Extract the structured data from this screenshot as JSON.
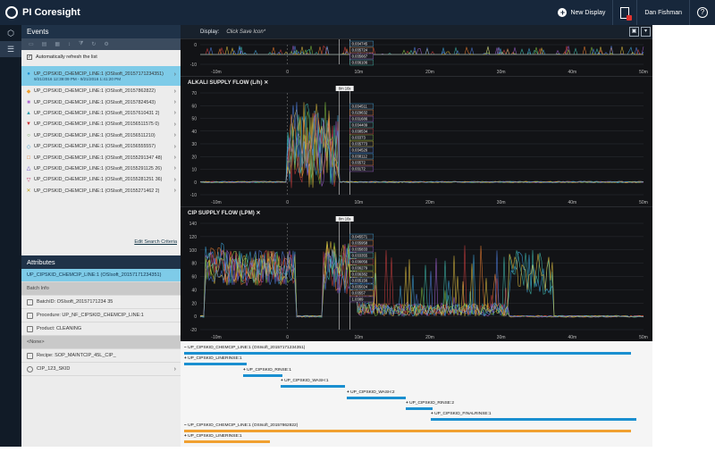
{
  "app": {
    "name_pi": "PI",
    "name_rest": "Coresight"
  },
  "topbar": {
    "new_display": "New Display",
    "user": "Dan Fishman",
    "help": "?"
  },
  "events": {
    "header": "Events",
    "auto_refresh": "Automatically refresh the list",
    "edit_search": "Edit Search Criteria",
    "items": [
      {
        "label": "UP_CIPSKID_CHEMCIP_LINE:1 (OSIsoft_20157171234351)",
        "sub": "9/21/2016 12:39:09 PM - 9/21/2016 1:41:20 PM",
        "marker": "●",
        "color": "#1a8fd0"
      },
      {
        "label": "UP_CIPSKID_CHEMCIP_LINE:1 (OSIsoft_20157862822)",
        "marker": "◆",
        "color": "#f0a030"
      },
      {
        "label": "UP_CIPSKID_CHEMCIP_LINE:1 (OSIsoft_20157824543)",
        "marker": "■",
        "color": "#b06ad0"
      },
      {
        "label": "UP_CIPSKID_CHEMCIP_LINE:1 (OSIsoft_20157610431 2)",
        "marker": "▲",
        "color": "#2a9fb0"
      },
      {
        "label": "UP_CIPSKID_CHEMCIP_LINE:1 (OSIsoft_20156511575 0)",
        "marker": "▼",
        "color": "#d03030"
      },
      {
        "label": "UP_CIPSKID_CHEMCIP_LINE:1 (OSIsoft_20156511210)",
        "marker": "○",
        "color": "#5a9a40"
      },
      {
        "label": "UP_CIPSKID_CHEMCIP_LINE:1 (OSIsoft_20156555557)",
        "marker": "◇",
        "color": "#40a0d0"
      },
      {
        "label": "UP_CIPSKID_CHEMCIP_LINE:1 (OSIsoft_20155291347 48)",
        "marker": "□",
        "color": "#e07020"
      },
      {
        "label": "UP_CIPSKID_CHEMCIP_LINE:1 (OSIsoft_20155291125 26)",
        "marker": "△",
        "color": "#6a4ad0"
      },
      {
        "label": "UP_CIPSKID_CHEMCIP_LINE:1 (OSIsoft_20155281251 36)",
        "marker": "▽",
        "color": "#c03060"
      },
      {
        "label": "UP_CIPSKID_CHEMCIP_LINE:1 (OSIsoft_20155271462 2)",
        "marker": "✕",
        "color": "#c0a020"
      }
    ]
  },
  "attributes": {
    "header": "Attributes",
    "selected": "UP_CIPSKID_CHEMCIP_LINE:1 (OSIsoft_20157171234351)",
    "group1": "Batch Info",
    "rows": [
      "BatchID: OSIsoft_20157171234 35",
      "Procedure: UP_NF_CIPSKID_CHEMCIP_LINE:1",
      "Product: CLEANING"
    ],
    "group2": "<None>",
    "rows2": [
      "Recipe: SOP_MAINTCIP_45L_CIP_",
      "CIP_123_SKID"
    ]
  },
  "display": {
    "label": "Display:",
    "hint": "Click Save Icon*",
    "save_icon": "floppy-icon",
    "menu_icon": "dropdown-icon"
  },
  "panes": [
    {
      "title": "",
      "yticks": [
        "0",
        "-10"
      ],
      "xticks": [
        "-10m",
        "0",
        "10m",
        "20m",
        "30m",
        "40m",
        "50m"
      ],
      "values": [
        "0.034745",
        "0.035724",
        "0.035667",
        "0.036106"
      ]
    },
    {
      "title": "ALKALI SUPPLY FLOW (L/h)",
      "badge": "8m 16s",
      "yticks": [
        "70",
        "60",
        "50",
        "40",
        "30",
        "20",
        "10",
        "0",
        "-10"
      ],
      "xticks": [
        "-10m",
        "0",
        "10m",
        "20m",
        "30m",
        "40m",
        "50m"
      ],
      "values": [
        "0.034511",
        "0.029632",
        "0.031686",
        "0.034409",
        "0.038534",
        "0.03373",
        "0.035773",
        "0.034526",
        "0.038112",
        "0.03572",
        "0.03172"
      ]
    },
    {
      "title": "CIP SUPPLY FLOW (LPM)",
      "badge": "8m 16s",
      "yticks": [
        "140",
        "120",
        "100",
        "80",
        "60",
        "40",
        "20",
        "0",
        "-20"
      ],
      "xticks": [
        "-10m",
        "0",
        "10m",
        "20m",
        "30m",
        "40m",
        "50m"
      ],
      "values": [
        "0.045571",
        "0.035958",
        "0.035833",
        "0.033355",
        "0.036056",
        "0.036279",
        "0.036382",
        "0.035156",
        "0.035024",
        "0.03557",
        "1.0389"
      ]
    }
  ],
  "gantt": {
    "rows": [
      {
        "label": "UP_CIPSKID_CHEMCIP_LINE:1 (OSIsoft_20157171234351)",
        "color": "#1a8fd0",
        "prefix": "−"
      },
      {
        "label": "UP_CIPSKID_LINERINSE:1",
        "color": "#1a8fd0",
        "prefix": "+"
      },
      {
        "label": "UP_CIPSKID_RINSE:1",
        "color": "#1a8fd0",
        "prefix": "+"
      },
      {
        "label": "UP_CIPSKID_WASH:1",
        "color": "#1a8fd0",
        "prefix": "+"
      },
      {
        "label": "UP_CIPSKID_WASH:2",
        "color": "#1a8fd0",
        "prefix": "+"
      },
      {
        "label": "UP_CIPSKID_RINSE:2",
        "color": "#1a8fd0",
        "prefix": "+"
      },
      {
        "label": "UP_CIPSKID_FINALRINSE:1",
        "color": "#1a8fd0",
        "prefix": "+"
      },
      {
        "label": "UP_CIPSKID_CHEMCIP_LINE:1 (OSIsoft_20157862822)",
        "color": "#f0a030",
        "prefix": "−"
      },
      {
        "label": "UP_CIPSKID_LINERINSE:1",
        "color": "#f0a030",
        "prefix": "+"
      }
    ]
  },
  "series_colors": [
    "#3fa9e0",
    "#f08030",
    "#a060d0",
    "#40c0b0",
    "#d04040",
    "#80c040",
    "#e0c040",
    "#5080e0"
  ]
}
